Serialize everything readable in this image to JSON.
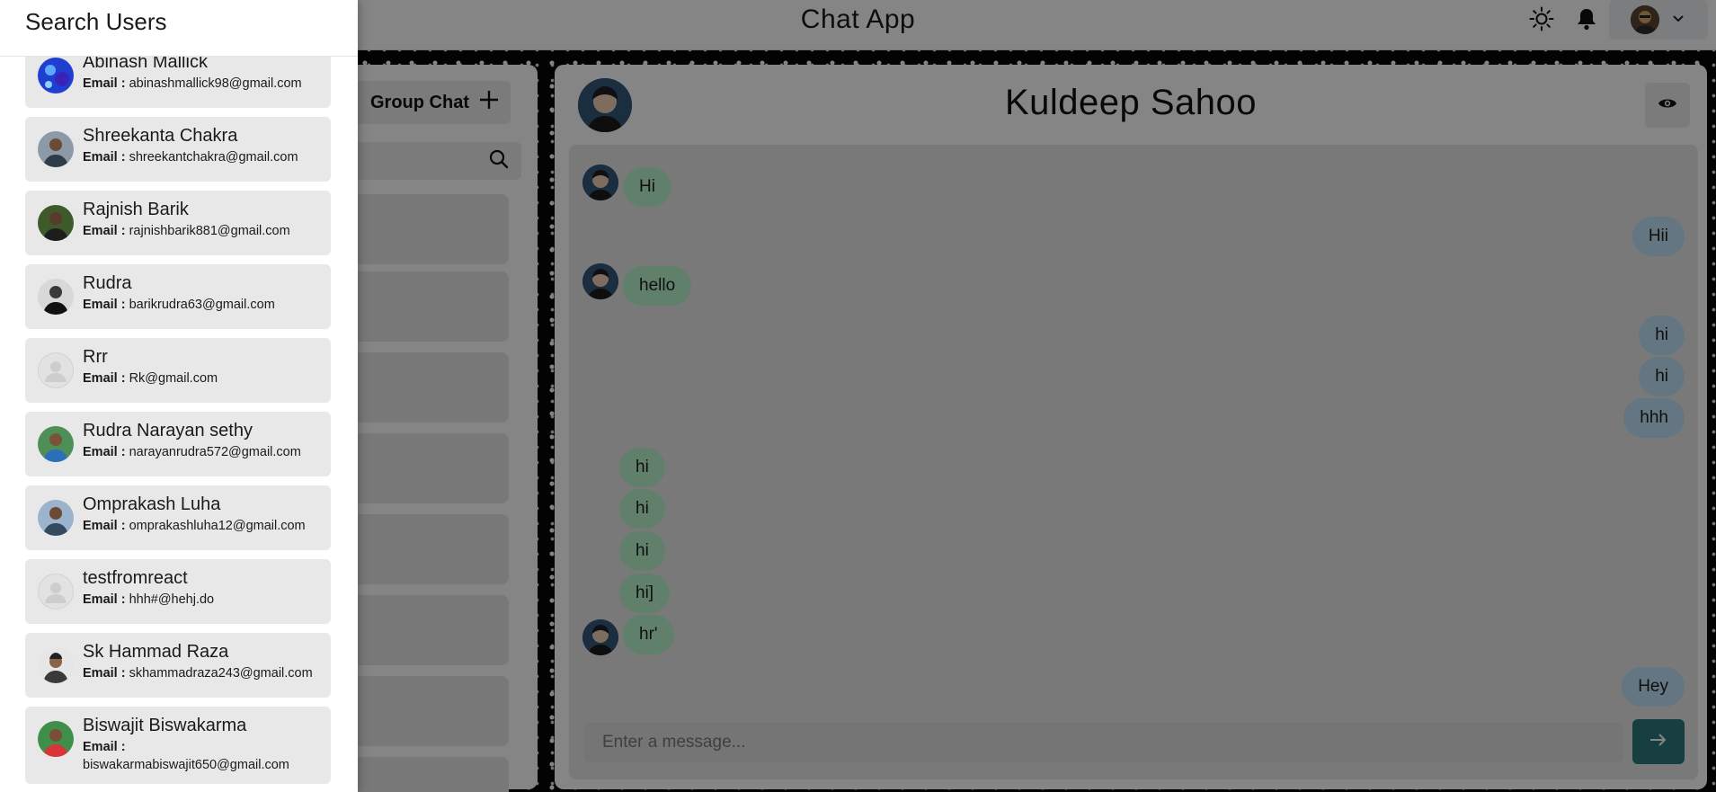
{
  "app": {
    "title": "Chat App"
  },
  "colors": {
    "accent": "#2c7a7b",
    "incoming_bubble": "#b9f5d0",
    "outgoing_bubble": "#bee3f8"
  },
  "header_icons": [
    "sun-icon",
    "bell-icon",
    "avatar",
    "chevron-down-icon"
  ],
  "sidebar": {
    "group_chat_label": "Group Chat"
  },
  "chat": {
    "name": "Kuldeep Sahoo",
    "input_placeholder": "Enter a message...",
    "messages": [
      {
        "text": "Hi",
        "direction": "in"
      },
      {
        "text": "Hii",
        "direction": "out"
      },
      {
        "text": "hello",
        "direction": "in"
      },
      {
        "text": "hi",
        "direction": "out"
      },
      {
        "text": "hi",
        "direction": "out"
      },
      {
        "text": "hhh",
        "direction": "out"
      },
      {
        "text": "hi",
        "direction": "in"
      },
      {
        "text": "hi",
        "direction": "in"
      },
      {
        "text": "hi",
        "direction": "in"
      },
      {
        "text": "hi]",
        "direction": "in"
      },
      {
        "text": "hr'",
        "direction": "in"
      },
      {
        "text": "Hey",
        "direction": "out"
      }
    ]
  },
  "drawer": {
    "title": "Search Users",
    "email_label": "Email :",
    "users": [
      {
        "name": "Abinash Mallick",
        "email": "abinashmallick98@gmail.com"
      },
      {
        "name": "Shreekanta Chakra",
        "email": "shreekantchakra@gmail.com"
      },
      {
        "name": "Rajnish Barik",
        "email": "rajnishbarik881@gmail.com"
      },
      {
        "name": "Rudra",
        "email": "barikrudra63@gmail.com"
      },
      {
        "name": "Rrr",
        "email": "Rk@gmail.com"
      },
      {
        "name": "Rudra Narayan sethy",
        "email": "narayanrudra572@gmail.com"
      },
      {
        "name": "Omprakash Luha",
        "email": "omprakashluha12@gmail.com"
      },
      {
        "name": "testfromreact",
        "email": "hhh#@hehj.do"
      },
      {
        "name": "Sk Hammad Raza",
        "email": "skhammadraza243@gmail.com"
      },
      {
        "name": "Biswajit Biswakarma",
        "email": "biswakarmabiswajit650@gmail.com"
      }
    ]
  }
}
